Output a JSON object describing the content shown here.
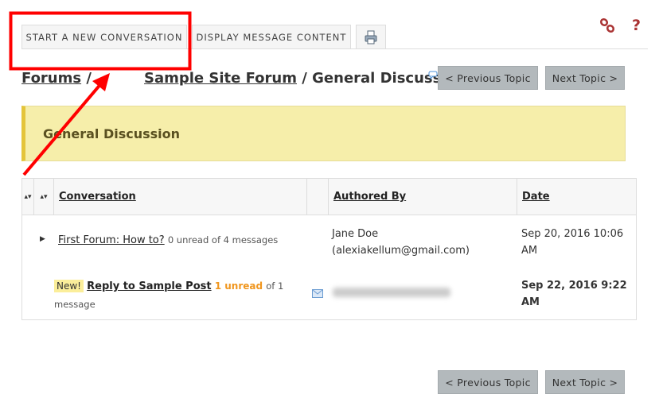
{
  "tabs": {
    "start": "START A NEW CONVERSATION",
    "display": "DISPLAY MESSAGE CONTENT",
    "print_icon": "printer-icon"
  },
  "top_icons": {
    "link": "link-icon",
    "help": "?"
  },
  "breadcrumb": {
    "forums": "Forums",
    "sep1": "/",
    "forum": "Sample Site Forum",
    "sep2": "/",
    "topic": "General Discussion"
  },
  "nav": {
    "prev": "< Previous Topic",
    "next": "Next Topic >"
  },
  "banner": {
    "title": "General Discussion"
  },
  "table": {
    "headers": {
      "conversation": "Conversation",
      "author": "Authored By",
      "date": "Date"
    },
    "rows": [
      {
        "title": "First Forum: How to?",
        "meta": "0 unread of 4 messages",
        "author_line1": "Jane Doe",
        "author_line2": "(alexiakellum@gmail.com)",
        "date_line1": "Sep 20, 2016 10:06",
        "date_line2": "AM"
      },
      {
        "badge": "New!",
        "title": "Reply to Sample Post",
        "unread": "1 unread",
        "meta_of": "of 1",
        "meta_line2": "message",
        "author_blurred": true,
        "date_line1": "Sep 22, 2016 9:22",
        "date_line2": "AM"
      }
    ]
  },
  "annotation": {
    "color": "#ff0000"
  }
}
